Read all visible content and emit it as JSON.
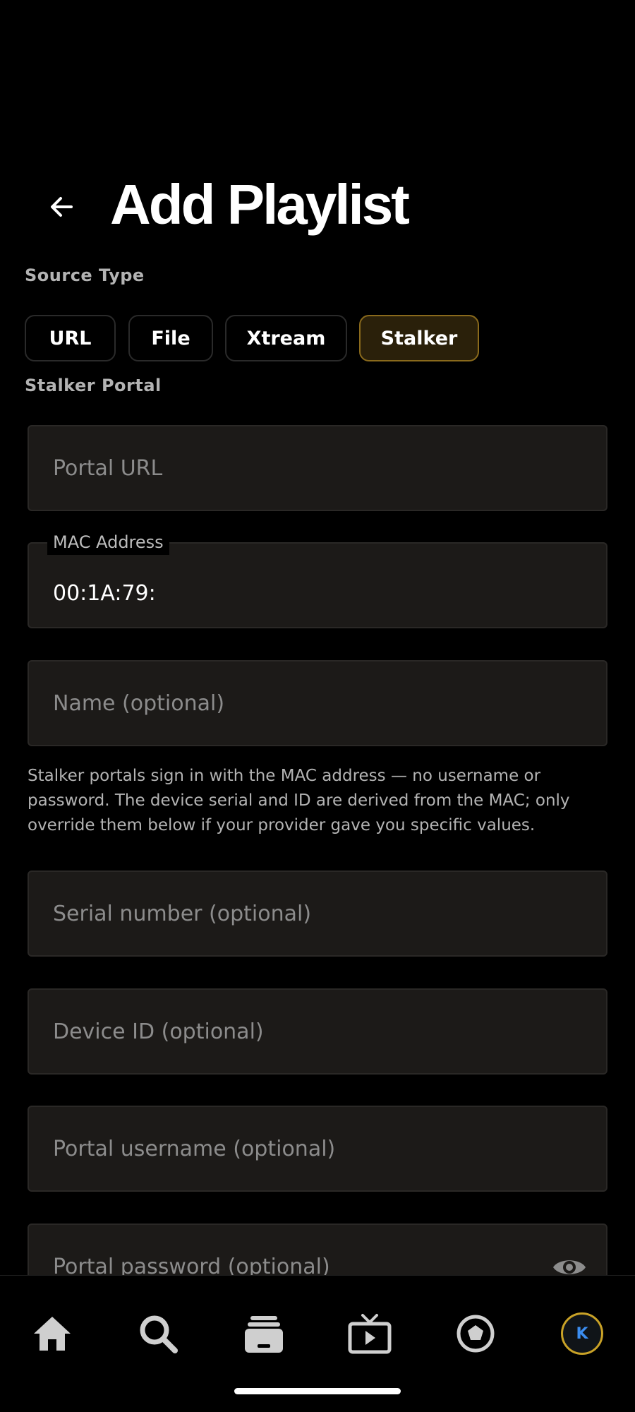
{
  "header": {
    "title": "Add Playlist"
  },
  "source_type": {
    "label": "Source Type",
    "options": [
      "URL",
      "File",
      "Xtream",
      "Stalker"
    ],
    "selected": "Stalker"
  },
  "stalker_portal": {
    "label": "Stalker Portal",
    "portal_url": {
      "placeholder": "Portal URL",
      "value": ""
    },
    "mac_address": {
      "label": "MAC Address",
      "value": "00:1A:79:"
    },
    "name": {
      "placeholder": "Name (optional)",
      "value": ""
    },
    "helper_text": "Stalker portals sign in with the MAC address — no username or password. The device serial and ID are derived from the MAC; only override them below if your provider gave you specific values.",
    "serial_number": {
      "placeholder": "Serial number (optional)",
      "value": ""
    },
    "device_id": {
      "placeholder": "Device ID (optional)",
      "value": ""
    },
    "portal_username": {
      "placeholder": "Portal username (optional)",
      "value": ""
    },
    "portal_password": {
      "placeholder": "Portal password (optional)",
      "value": ""
    }
  },
  "bottom_nav": {
    "items": [
      {
        "name": "home",
        "icon": "home-icon"
      },
      {
        "name": "search",
        "icon": "search-icon"
      },
      {
        "name": "library",
        "icon": "library-icon"
      },
      {
        "name": "live-tv",
        "icon": "tv-play-icon"
      },
      {
        "name": "sports",
        "icon": "soccer-ball-icon"
      },
      {
        "name": "profile",
        "icon": "avatar",
        "initial": "K"
      }
    ]
  },
  "colors": {
    "background": "#000000",
    "field_bg": "#1c1a18",
    "selected_chip_bg": "#2a200a",
    "selected_chip_border": "#8a6a1c",
    "avatar_ring": "#c9a227",
    "avatar_text": "#3b8df0"
  }
}
